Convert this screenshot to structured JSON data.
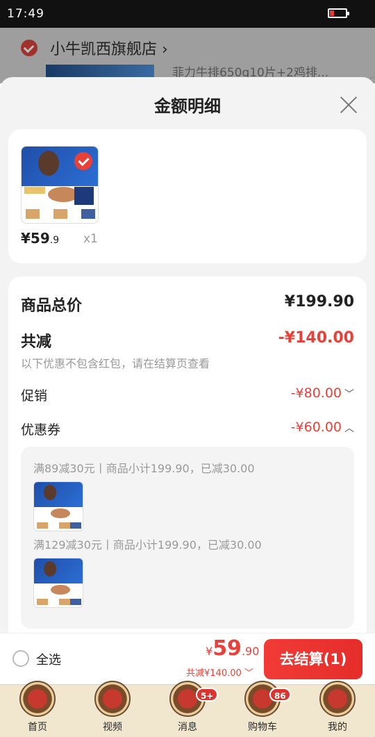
{
  "status_bar": {
    "time": "17:49",
    "battery_level": 0.25
  },
  "background": {
    "store_name": "小牛凯西旗舰店",
    "store_chevron": "›",
    "product_name": "菲力牛排650g10片+2鸡排..."
  },
  "sheet": {
    "title": "金额明细"
  },
  "item": {
    "price_main": "¥59",
    "price_decimal": ".9",
    "quantity": "x1"
  },
  "summary": {
    "total_label": "商品总价",
    "total_value": "¥199.90",
    "discount_label": "共减",
    "discount_value": "-¥140.00",
    "discount_note": "以下优惠不包含红包，请在结算页查看",
    "promo_label": "促销",
    "promo_value": "-¥80.00",
    "promo_chevron": "﹀",
    "coupon_label": "优惠券",
    "coupon_value": "-¥60.00",
    "coupon_chevron": "︿"
  },
  "coupons": [
    {
      "desc": "满89减30元丨商品小计199.90，已减30.00"
    },
    {
      "desc": "满129减30元丨商品小计199.90，已减30.00"
    }
  ],
  "checkout": {
    "select_all": "全选",
    "currency": "¥",
    "total_int": "59",
    "total_dec": ".90",
    "saved_text": "共减¥140.00 ﹀",
    "pay_button": "去结算(1)"
  },
  "tabs": [
    {
      "label": "首页"
    },
    {
      "label": "视频"
    },
    {
      "label": "消息",
      "badge": "5+"
    },
    {
      "label": "购物车",
      "badge": "86"
    },
    {
      "label": "我的"
    }
  ],
  "colors": {
    "accent": "#e8413a",
    "tab_bg": "#f1e7cf"
  }
}
